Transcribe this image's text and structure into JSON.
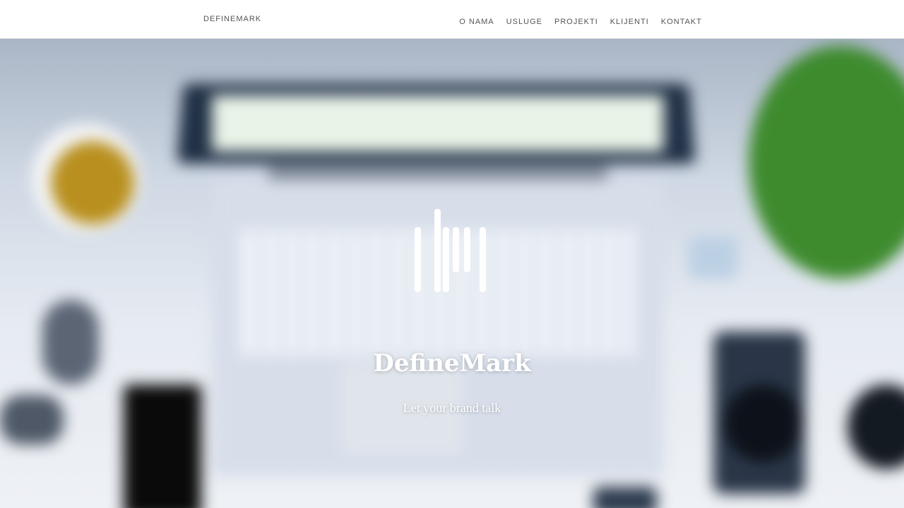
{
  "header": {
    "brand": "DEFINEMARK",
    "nav": [
      {
        "label": "O NAMA"
      },
      {
        "label": "USLUGE"
      },
      {
        "label": "PROJEKTI"
      },
      {
        "label": "KLIJENTI"
      },
      {
        "label": "KONTAKT"
      }
    ]
  },
  "hero": {
    "logo_icon": "dm-monogram-icon",
    "title": "DefineMark",
    "subtitle": "Let your brand talk"
  },
  "colors": {
    "nav_text": "#555555",
    "hero_text": "#ffffff"
  }
}
